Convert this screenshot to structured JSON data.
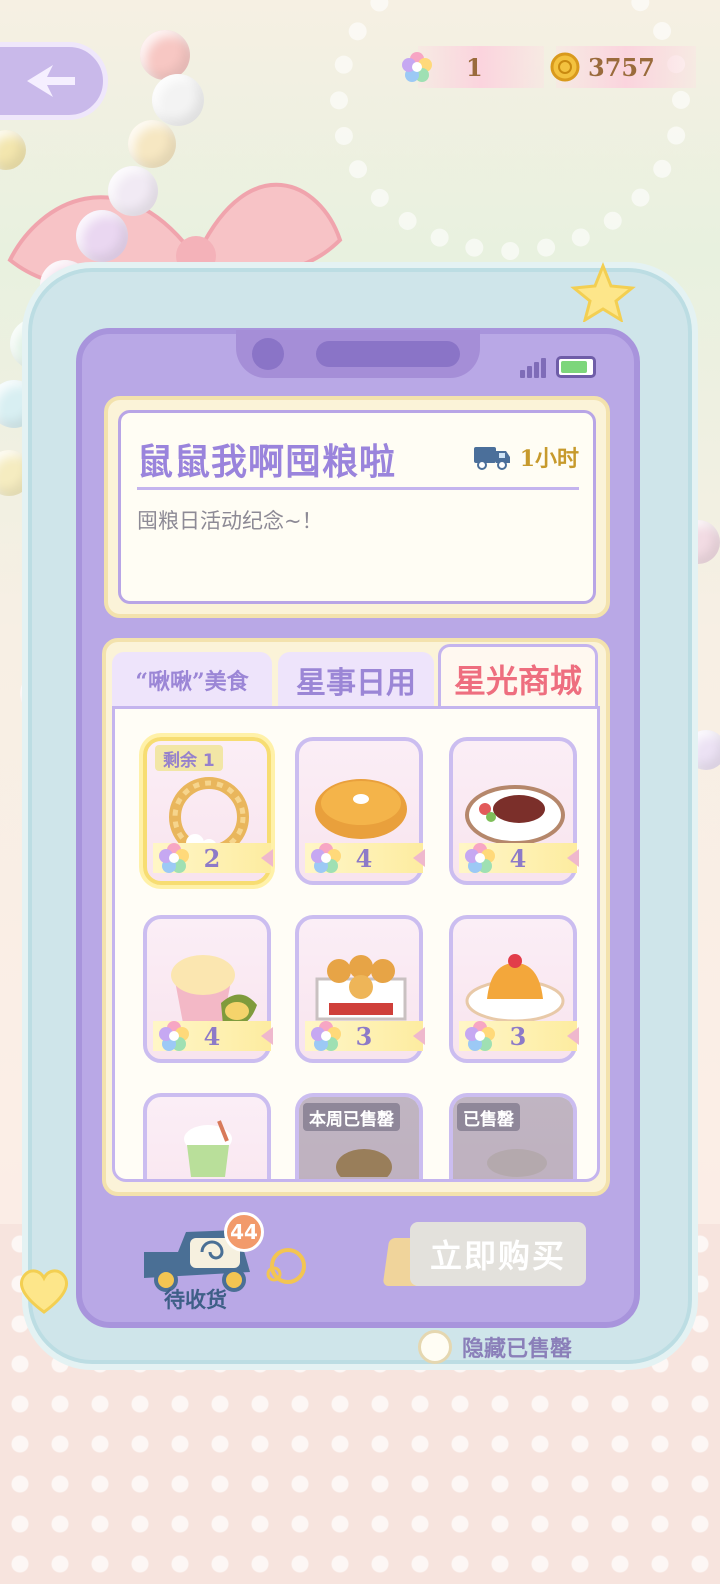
{
  "resources": {
    "star_count": "1",
    "coin_count": "3757"
  },
  "shop": {
    "title": "鼠鼠我啊囤粮啦",
    "timer": "1小时",
    "description": "囤粮日活动纪念~！"
  },
  "tabs": [
    {
      "label": "“啾啾”美食",
      "active": false
    },
    {
      "label": "星事日用",
      "active": false
    },
    {
      "label": "星光商城",
      "active": true
    }
  ],
  "items": [
    {
      "name": "wheat-wreath",
      "price": "2",
      "badge": "剩余 1",
      "highlight": true
    },
    {
      "name": "pumpkin-pie",
      "price": "4"
    },
    {
      "name": "steak-plate",
      "price": "4"
    },
    {
      "name": "durian-shaved-ice",
      "price": "4"
    },
    {
      "name": "egg-tarts-box",
      "price": "3"
    },
    {
      "name": "pudding-plate",
      "price": "3"
    },
    {
      "name": "matcha-drink",
      "price": ""
    },
    {
      "name": "sold-week-item",
      "price": "",
      "sold_label": "本周已售罄"
    },
    {
      "name": "sold-item",
      "price": "",
      "sold_label": "已售罄"
    }
  ],
  "bottom": {
    "pending_count": "44",
    "pending_label": "待收货",
    "buy_label": "立即购买",
    "hide_sold_label": "隐藏已售罄"
  },
  "colors": {
    "accent_purple": "#9a84dc",
    "active_tab_red": "#ee6e7f",
    "coin_gold": "#c79a2c"
  }
}
